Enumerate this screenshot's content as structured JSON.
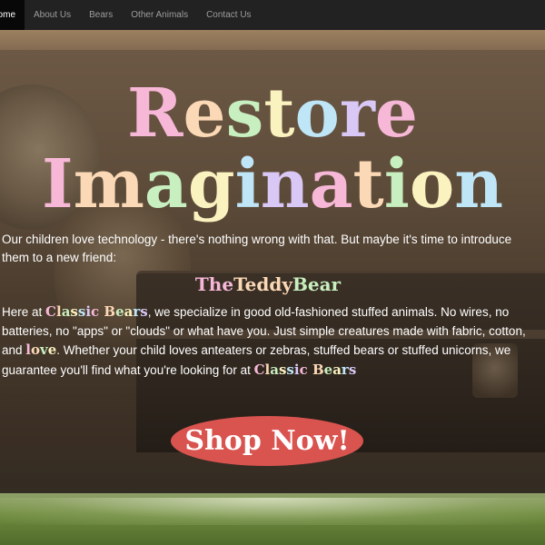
{
  "navbar": {
    "items": [
      {
        "label": "ome"
      },
      {
        "label": "About Us"
      },
      {
        "label": "Bears"
      },
      {
        "label": "Other Animals"
      },
      {
        "label": "Contact Us"
      }
    ]
  },
  "hero": {
    "title_line1": [
      "R",
      "e",
      "s",
      "t",
      "o",
      "r",
      "e"
    ],
    "title_line2": [
      "I",
      "m",
      "a",
      "g",
      "i",
      "n",
      "a",
      "t",
      "i",
      "o",
      "n"
    ],
    "intro": "Our children love technology - there's nothing wrong with that. But maybe it's time to introduce them to a new friend:",
    "subtitle": [
      "The ",
      "Teddy ",
      "Bear"
    ],
    "body_part1": "Here at ",
    "brand_letters_1": [
      "C",
      "l",
      "a",
      "s",
      "s",
      "i",
      "c",
      " ",
      "B",
      "e",
      "a",
      "r",
      "s"
    ],
    "body_part2": ", we specialize in good old-fashioned stuffed animals. No wires, no batteries, no \"apps\" or \"clouds\" or what have you. Just simple creatures made with fabric, cotton, and ",
    "love_letters": [
      "l",
      "o",
      "v",
      "e"
    ],
    "body_part3": ". Whether your child loves anteaters or zebras, stuffed bears or stuffed unicorns, we guarantee you'll find what you're looking for at ",
    "brand_letters_2": [
      "C",
      "l",
      "a",
      "s",
      "s",
      "i",
      "c",
      " ",
      "B",
      "e",
      "a",
      "r",
      "s"
    ],
    "shop_button": "Shop Now!"
  },
  "colors": {
    "pastel_pink": "#f7b8d8",
    "pastel_peach": "#fcd9b6",
    "pastel_green": "#c8efbf",
    "pastel_yellow": "#faf2bf",
    "pastel_blue": "#bfe6f7",
    "pastel_lavender": "#d9c7f5",
    "button_red": "#d9534f",
    "navbar_bg": "#222222",
    "navbar_active_bg": "#080808"
  }
}
